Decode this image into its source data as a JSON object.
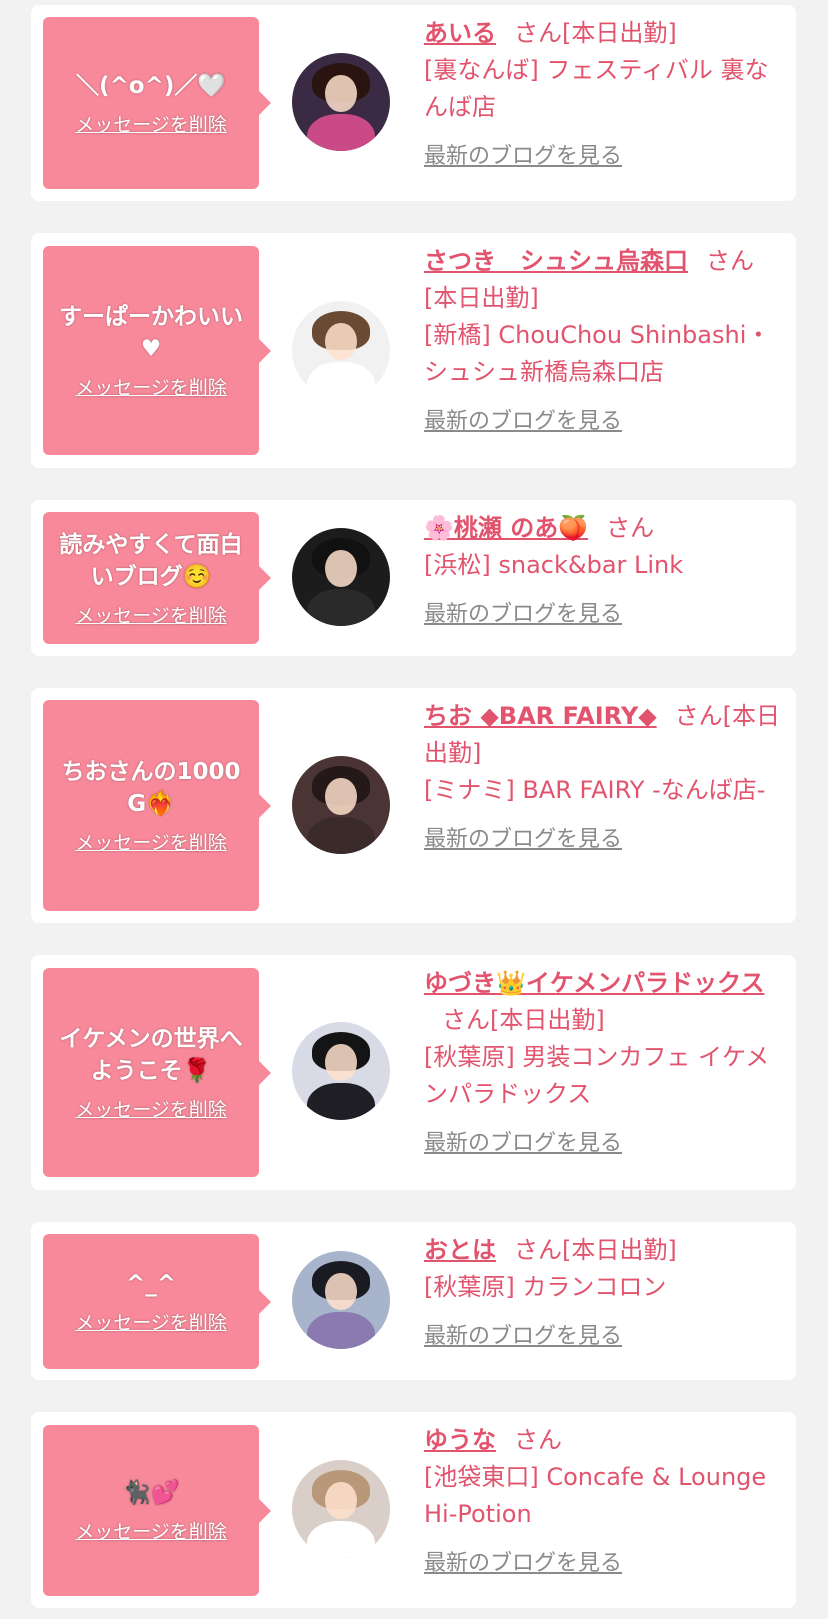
{
  "cards": [
    {
      "message": "＼(^o^)／🤍",
      "delete_label": "メッセージを削除",
      "name": "あいる",
      "honorific": "さん",
      "status": "[本日出勤]",
      "shop": "[裏なんば] フェスティバル 裏なんば店",
      "blog_label": "最新のブログを見る",
      "avatar_colors": {
        "bg": "#3a2a44",
        "hair": "#2a1410",
        "body": "#c94a86"
      }
    },
    {
      "message": "すーぱーかわいい♥",
      "delete_label": "メッセージを削除",
      "name": "さつき　シュシュ烏森口",
      "honorific": "さん",
      "status": "[本日出勤]",
      "shop": "[新橋] ChouChou Shinbashi・シュシュ新橋烏森口店",
      "blog_label": "最新のブログを見る",
      "avatar_colors": {
        "bg": "#f1f1f1",
        "hair": "#6b4a34",
        "body": "#ffffff"
      }
    },
    {
      "message": "読みやすくて面白いブログ☺️",
      "delete_label": "メッセージを削除",
      "name": "🌸桃瀬 のあ🍑",
      "honorific": "さん",
      "status": "",
      "shop": "[浜松] snack&bar Link",
      "blog_label": "最新のブログを見る",
      "avatar_colors": {
        "bg": "#1c1c1c",
        "hair": "#111111",
        "body": "#2a2a2a"
      }
    },
    {
      "message": "ちおさんの1000G❤️‍🔥",
      "delete_label": "メッセージを削除",
      "name": "ちお ◆BAR FAIRY◆",
      "honorific": "さん",
      "status": "[本日出勤]",
      "shop": "[ミナミ] BAR FAIRY -なんば店-",
      "blog_label": "最新のブログを見る",
      "avatar_colors": {
        "bg": "#4a3434",
        "hair": "#241818",
        "body": "#3a2a2a"
      }
    },
    {
      "message": "イケメンの世界へようこそ🌹",
      "delete_label": "メッセージを削除",
      "name": "ゆづき👑イケメンパラドックス",
      "honorific": "さん",
      "status": "[本日出勤]",
      "shop": "[秋葉原] 男装コンカフェ イケメンパラドックス",
      "blog_label": "最新のブログを見る",
      "avatar_colors": {
        "bg": "#d8dbe6",
        "hair": "#141414",
        "body": "#1e1e24"
      }
    },
    {
      "message": "^_^",
      "delete_label": "メッセージを削除",
      "name": "おとは",
      "honorific": "さん",
      "status": "[本日出勤]",
      "shop": "[秋葉原] カランコロン",
      "blog_label": "最新のブログを見る",
      "avatar_colors": {
        "bg": "#a7b4cc",
        "hair": "#1a1a22",
        "body": "#8a7ab0"
      }
    },
    {
      "message": "🐈‍⬛💕",
      "delete_label": "メッセージを削除",
      "name": "ゆうな",
      "honorific": "さん",
      "status": "",
      "shop": "[池袋東口] Concafe & Lounge Hi-Potion",
      "blog_label": "最新のブログを見る",
      "avatar_colors": {
        "bg": "#d9cfc8",
        "hair": "#b89878",
        "body": "#ffffff"
      }
    }
  ]
}
